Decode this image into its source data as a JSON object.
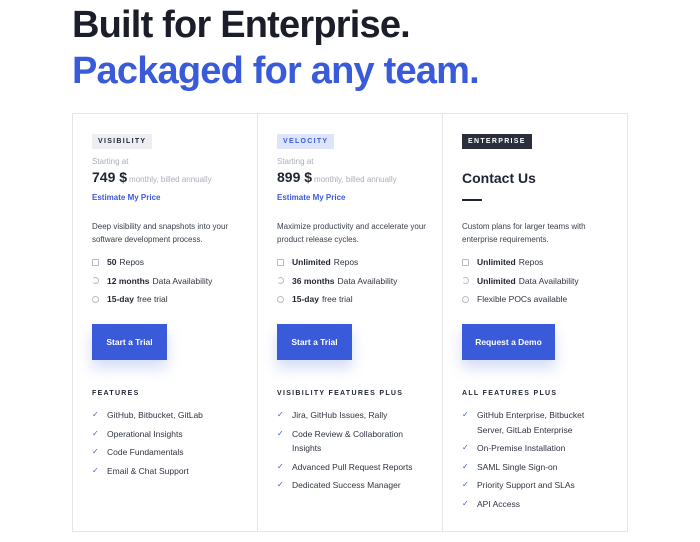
{
  "headline": {
    "line1": "Built for Enterprise.",
    "line2": "Packaged for any team."
  },
  "colors": {
    "accent": "#3a5bd9",
    "text": "#1f2433",
    "muted": "#a9aebb",
    "border": "#e3e5ea"
  },
  "icons": {
    "check": "✓",
    "repos": "repo-icon",
    "data": "history-icon",
    "trial": "clock-icon"
  },
  "plans": [
    {
      "badge": "VISIBILITY",
      "starting": "Starting at",
      "price": "749 $",
      "period": "monthly, billed annually",
      "estimate": "Estimate My Price",
      "description": "Deep visibility and snapshots into your software development process.",
      "specs": [
        {
          "strong": "50",
          "text": "Repos"
        },
        {
          "strong": "12 months",
          "text": "Data Availability"
        },
        {
          "strong": "15-day",
          "text": "free trial"
        }
      ],
      "cta": "Start a Trial",
      "features_title": "FEATURES",
      "features": [
        "GitHub, Bitbucket, GitLab",
        "Operational Insights",
        "Code Fundamentals",
        "Email & Chat Support"
      ]
    },
    {
      "badge": "VELOCITY",
      "starting": "Starting at",
      "price": "899 $",
      "period": "monthly, billed annually",
      "estimate": "Estimate My Price",
      "description": "Maximize productivity and accelerate your product release cycles.",
      "specs": [
        {
          "strong": "Unlimited",
          "text": "Repos"
        },
        {
          "strong": "36 months",
          "text": "Data Availability"
        },
        {
          "strong": "15-day",
          "text": "free trial"
        }
      ],
      "cta": "Start a Trial",
      "features_title": "VISIBILITY FEATURES PLUS",
      "features": [
        "Jira, GitHub Issues, Rally",
        "Code Review & Collaboration Insights",
        "Advanced Pull Request Reports",
        "Dedicated Success Manager"
      ]
    },
    {
      "badge": "ENTERPRISE",
      "title": "Contact Us",
      "description": "Custom plans for larger teams with enterprise requirements.",
      "specs": [
        {
          "strong": "Unlimited",
          "text": "Repos"
        },
        {
          "strong": "Unlimited",
          "text": "Data Availability"
        },
        {
          "strong": "",
          "text": "Flexible POCs available"
        }
      ],
      "cta": "Request a Demo",
      "features_title": "ALL FEATURES PLUS",
      "features": [
        "GitHub Enterprise, Bitbucket Server, GitLab Enterprise",
        "On-Premise Installation",
        "SAML Single Sign-on",
        "Priority Support and SLAs",
        "API Access"
      ]
    }
  ]
}
